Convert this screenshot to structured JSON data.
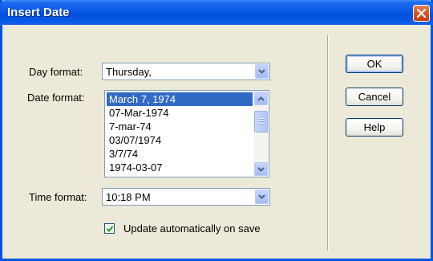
{
  "window": {
    "title": "Insert Date"
  },
  "form": {
    "day_format_label": "Day format:",
    "day_format_value": "Thursday,",
    "date_format_label": "Date format:",
    "date_formats": [
      "March 7, 1974",
      "07-Mar-1974",
      "7-mar-74",
      "03/07/1974",
      "3/7/74",
      "1974-03-07"
    ],
    "selected_date_format": "March 7, 1974",
    "time_format_label": "Time format:",
    "time_format_value": "10:18 PM",
    "update_checkbox_label": "Update automatically on save",
    "update_checked": true
  },
  "buttons": {
    "ok": "OK",
    "cancel": "Cancel",
    "help": "Help"
  },
  "colors": {
    "titlebar": "#0A58E6",
    "selection": "#316AC5",
    "dialog_bg": "#ECE9D8"
  },
  "icons": {
    "close": "close-icon",
    "dropdown": "chevron-down-icon",
    "scroll_up": "chevron-up-icon",
    "scroll_down": "chevron-down-icon",
    "checkmark": "checkmark-icon"
  }
}
